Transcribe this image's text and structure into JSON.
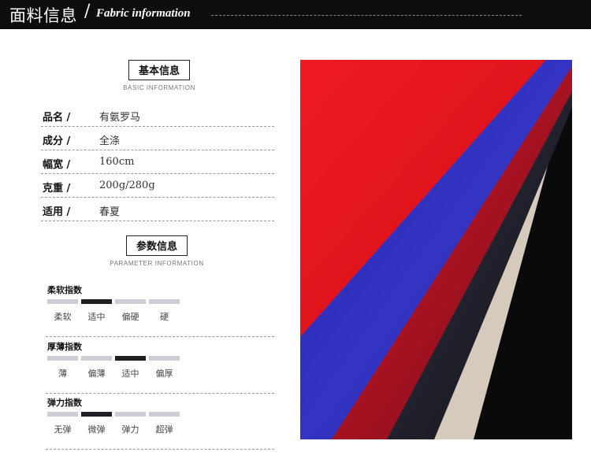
{
  "header": {
    "title_cn": "面料信息",
    "slash": "/",
    "title_en": "Fabric information"
  },
  "basic": {
    "title": "基本信息",
    "subtitle": "BASIC INFORMATION",
    "rows": [
      {
        "key": "品名 /",
        "value": "有氨罗马"
      },
      {
        "key": "成分 /",
        "value": "全涤"
      },
      {
        "key": "幅宽 /",
        "value": "160cm"
      },
      {
        "key": "克重 /",
        "value": "200g/280g"
      },
      {
        "key": "适用 /",
        "value": "春夏"
      }
    ]
  },
  "parameters": {
    "title": "参数信息",
    "subtitle": "PARAMETER INFORMATION",
    "groups": [
      {
        "name": "柔软指数",
        "options": [
          "柔软",
          "适中",
          "偏硬",
          "硬"
        ],
        "selected_index": 1
      },
      {
        "name": "厚薄指数",
        "options": [
          "薄",
          "偏薄",
          "适中",
          "偏厚"
        ],
        "selected_index": 2
      },
      {
        "name": "弹力指数",
        "options": [
          "无弹",
          "微弹",
          "弹力",
          "超弹"
        ],
        "selected_index": 1
      }
    ]
  },
  "colors": {
    "header_bg": "#0d0d0d",
    "bar_selected": "#1f1f26",
    "bar_unselected": "#cdcdd6",
    "fabric_red": "#e3131d",
    "fabric_blue": "#2a2ab0",
    "fabric_crimson": "#9d0f1f",
    "fabric_navy": "#1a1a26",
    "fabric_black": "#0b0b0b"
  }
}
